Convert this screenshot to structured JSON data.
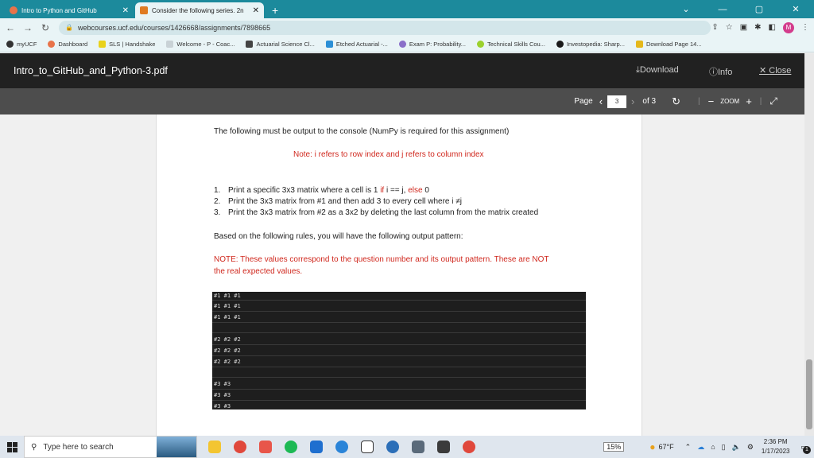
{
  "browser": {
    "tabs": [
      {
        "title": "Intro to Python and GitHub",
        "active": false
      },
      {
        "title": "Consider the following series. 2n",
        "active": true
      }
    ],
    "url": "webcourses.ucf.edu/courses/1426668/assignments/7898665",
    "profile_initial": "M",
    "bookmarks": [
      "myUCF",
      "Dashboard",
      "SLS | Handshake",
      "Welcome - P - Coac...",
      "Actuarial Science Cl...",
      "Etched Actuarial -...",
      "Exam P: Probability...",
      "Technical Skills Cou...",
      "Investopedia: Sharp...",
      "Download Page 14..."
    ]
  },
  "pdf": {
    "filename": "Intro_to_GitHub_and_Python-3.pdf",
    "actions": {
      "download": "Download",
      "info": "Info",
      "close": "Close"
    },
    "toolbar": {
      "page_label": "Page",
      "page_current": "3",
      "page_total": "of 3",
      "zoom_label": "ZOOM"
    }
  },
  "document": {
    "intro": "The following must be output to the console (NumPy is required for this assignment)",
    "note": "Note: i refers to row index and j refers to column index",
    "list": [
      {
        "num": "1.",
        "pre": "Print a specific 3x3 matrix where a cell is 1 ",
        "red1": "if",
        "mid": " i == j, ",
        "red2": "else",
        "post": " 0"
      },
      {
        "num": "2.",
        "text": "Print the 3x3 matrix from #1 and then add 3 to every cell where i ≠j"
      },
      {
        "num": "3.",
        "text": "Print the 3x3 matrix from #2 as a 3x2 by deleting the last column from the matrix created"
      }
    ],
    "rules": "Based on the following rules, you will have the following output pattern:",
    "note2_line1": "NOTE: These values correspond to the question number and its output pattern. These are NOT",
    "note2_line2": "the real expected values.",
    "console_lines": [
      "#1 #1 #1",
      "#1 #1 #1",
      "#1 #1 #1",
      "#2 #2 #2",
      "#2 #2 #2",
      "#2 #2 #2",
      "#3 #3",
      "#3 #3",
      "#3 #3"
    ]
  },
  "taskbar": {
    "search_placeholder": "Type here to search",
    "battery": "15%",
    "weather": "67°F",
    "time": "2:36 PM",
    "date": "1/17/2023",
    "notification_count": "1"
  }
}
